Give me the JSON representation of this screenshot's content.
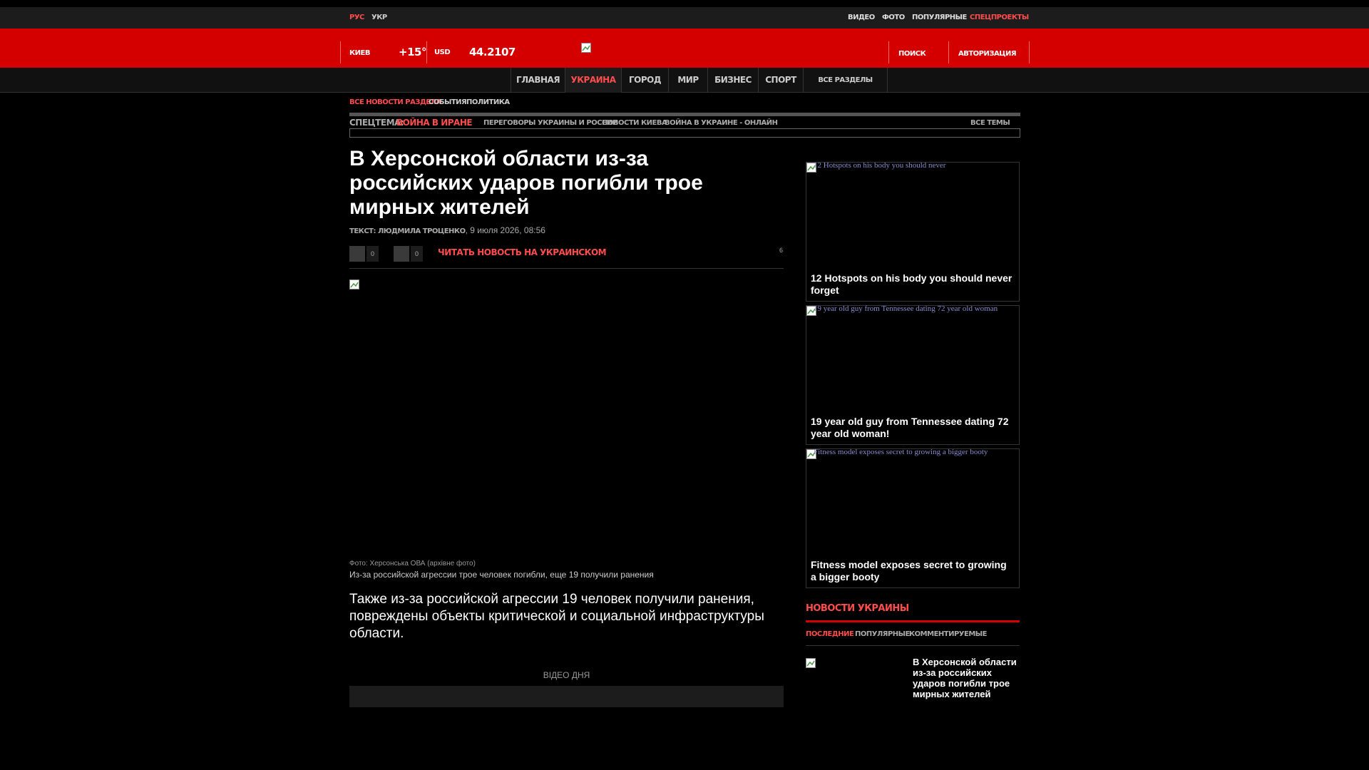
{
  "languages": [
    {
      "label": "РУС",
      "active": true
    },
    {
      "label": "УКР",
      "active": false
    }
  ],
  "top_nav": [
    "ВИДЕО",
    "ФОТО",
    "ПОПУЛЯРНЫЕ",
    "СПЕЦПРОЕКТЫ"
  ],
  "header": {
    "city": "КИЕВ",
    "temperature": "+15°",
    "currency": "USD",
    "rate": "44.2107",
    "search_label": "ПОИСК",
    "auth_label": "АВТОРИЗАЦИЯ"
  },
  "main_nav": [
    {
      "label": "ГЛАВНАЯ",
      "active": false
    },
    {
      "label": "УКРАИНА",
      "active": true
    },
    {
      "label": "ГОРОД",
      "active": false
    },
    {
      "label": "МИР",
      "active": false
    },
    {
      "label": "БИЗНЕС",
      "active": false
    },
    {
      "label": "СПОРТ",
      "active": false
    },
    {
      "label": "ВСЕ РАЗДЕЛЫ",
      "active": false
    }
  ],
  "sub_nav": [
    {
      "label": "ВСЕ НОВОСТИ РАЗДЕЛА",
      "active": true
    },
    {
      "label": "СОБЫТИЯ",
      "active": false
    },
    {
      "label": "ПОЛИТИКА",
      "active": false
    }
  ],
  "special_theme": {
    "prefix": "СПЕЦТЕМА:",
    "highlight": "ВОЙНА В ИРАНЕ",
    "items": [
      "ПЕРЕГОВОРЫ УКРАИНЫ И РОССИИ",
      "НОВОСТИ КИЕВА",
      "ВОЙНА В УКРАИНЕ - ОНЛАЙН"
    ],
    "all_label": "ВСЕ ТЕМЫ"
  },
  "article": {
    "headline": "В Херсонской области из-за российских ударов погибли трое мирных жителей",
    "author": "ТЕКСТ: ЛЮДМИЛА ТРОЦЕНКО",
    "date": "9 июля 2026, 08:56",
    "share_count_1": "0",
    "share_count_2": "0",
    "read_ukr": "ЧИТАТЬ НОВОСТЬ НА УКРАИНСКОМ",
    "views": "6",
    "photo_credit": "Фото: Херсонська ОВА (архівне фото)",
    "photo_caption": "Из-за российской агрессии трое человек погибли, еще 19 получили ранения",
    "lead": "Также из-за российской агрессии 19 человек получили ранения, повреждены объекты критической и социальной инфраструктуры области.",
    "video_label": "ВІДЕО ДНЯ"
  },
  "promos": [
    {
      "alt": "12 Hotspots on his body you should never",
      "title": "12 Hotspots on his body you should never forget"
    },
    {
      "alt": "19 year old guy from Tennessee dating 72 year old woman",
      "title": "19 year old guy from Tennessee dating 72 year old woman!"
    },
    {
      "alt": "Fitness model exposes secret to growing a bigger booty",
      "title": "Fitness model exposes secret to growing a bigger booty"
    }
  ],
  "sidebar_news": {
    "heading": "НОВОСТИ УКРАИНЫ",
    "tabs": [
      {
        "label": "ПОСЛЕДНИЕ",
        "active": true
      },
      {
        "label": "ПОПУЛЯРНЫЕ",
        "active": false
      },
      {
        "label": "КОММЕНТИРУЕМЫЕ",
        "active": false
      }
    ],
    "first_item": "В Херсонской области из-за российских ударов погибли трое мирных жителей"
  },
  "colors": {
    "accent": "#d40000",
    "accent_text": "#ff4c4c",
    "background": "#000000"
  }
}
